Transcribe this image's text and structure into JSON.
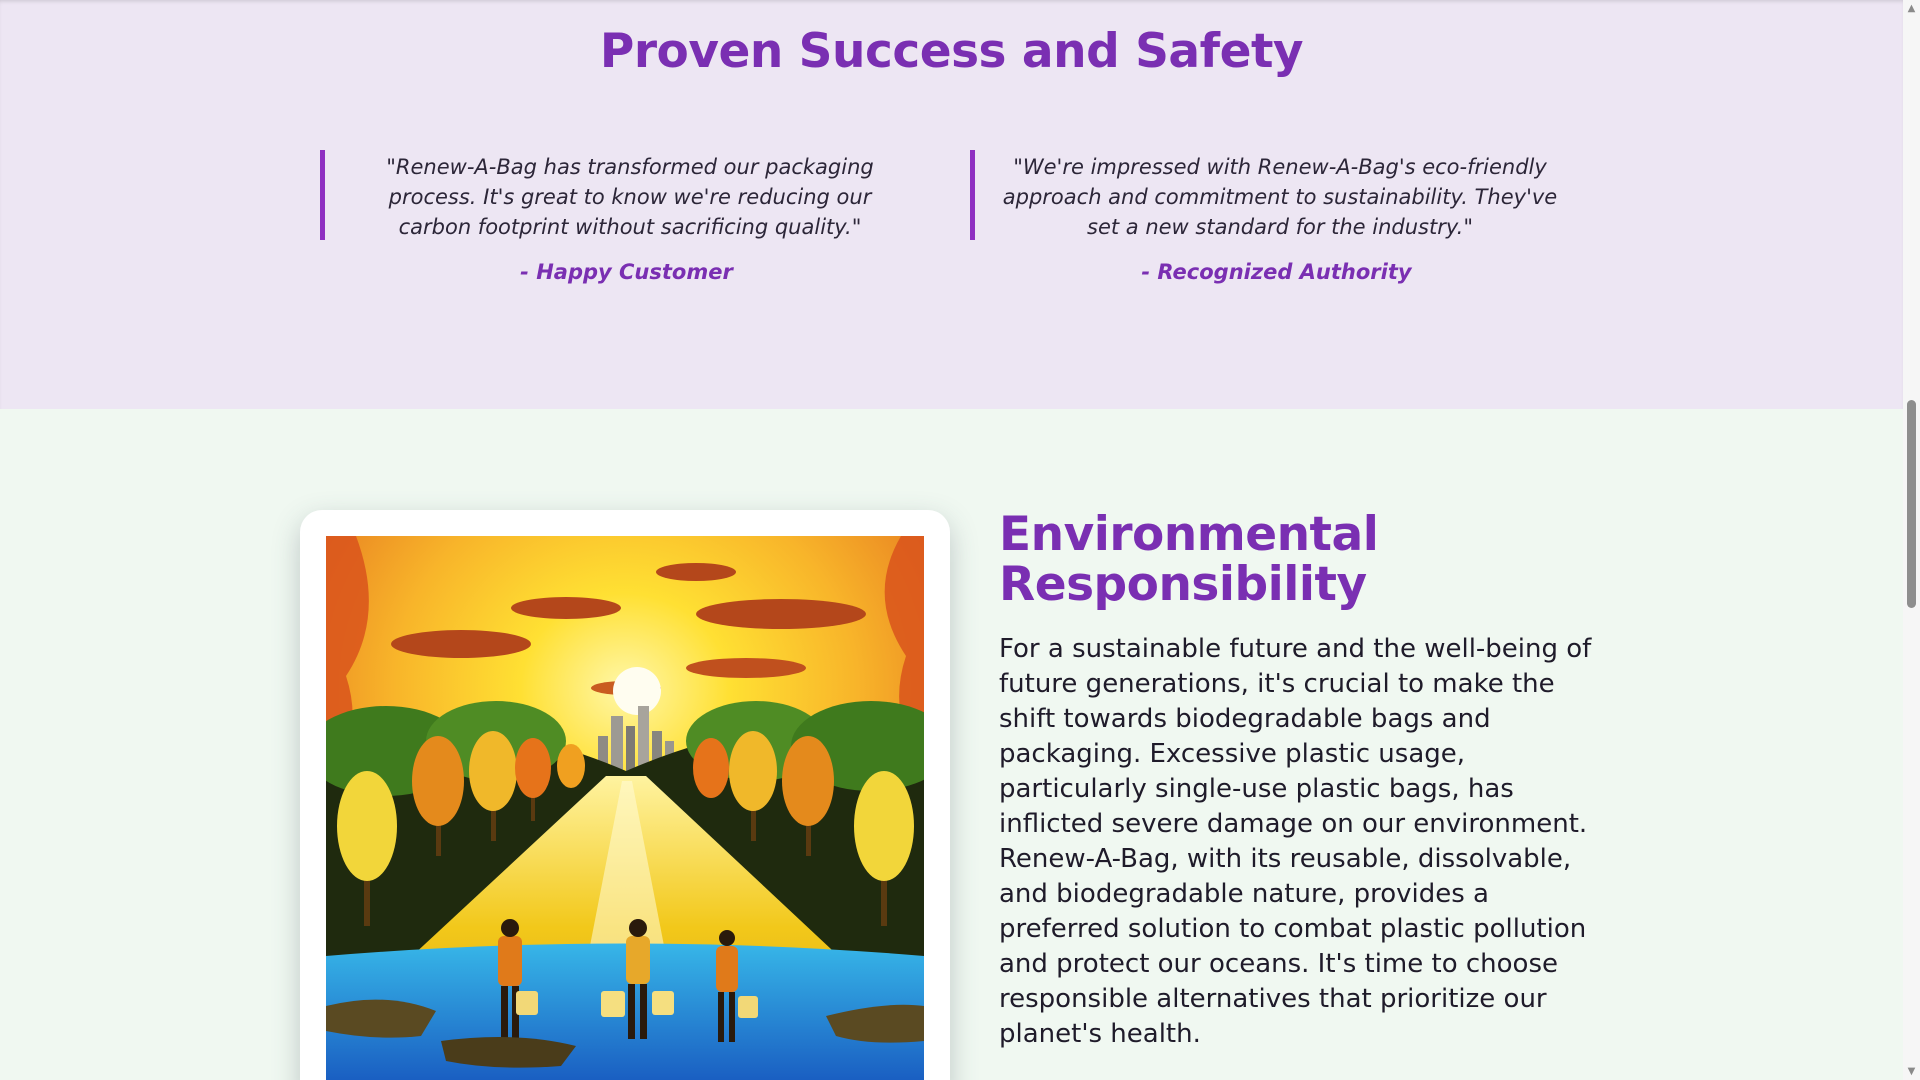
{
  "testimonials": {
    "heading": "Proven Success and Safety",
    "items": [
      {
        "quote": "\"Renew-A-Bag has transformed our packaging process. It's great to know we're reducing our carbon footprint without sacrificing quality.\"",
        "author": "- Happy Customer"
      },
      {
        "quote": "\"We're impressed with Renew-A-Bag's eco-friendly approach and commitment to sustainability. They've set a new standard for the industry.\"",
        "author": "- Recognized Authority"
      }
    ]
  },
  "environment": {
    "heading": "Environmental Responsibility",
    "body": "For a sustainable future and the well-being of future generations, it's crucial to make the shift towards biodegradable bags and packaging. Excessive plastic usage, particularly single-use plastic bags, has inflicted severe damage on our environment. Renew-A-Bag, with its reusable, dissolvable, and biodegradable nature, provides a preferred solution to combat plastic pollution and protect our oceans. It's time to choose responsible alternatives that prioritize our planet's health."
  },
  "colors": {
    "accent_purple": "#7a2fb2",
    "testimonial_bg": "#ede6f3",
    "environment_bg": "#f0f8f1"
  },
  "icons": {
    "scroll_up": "scroll-up-arrow-icon",
    "scroll_down": "scroll-down-arrow-icon"
  }
}
